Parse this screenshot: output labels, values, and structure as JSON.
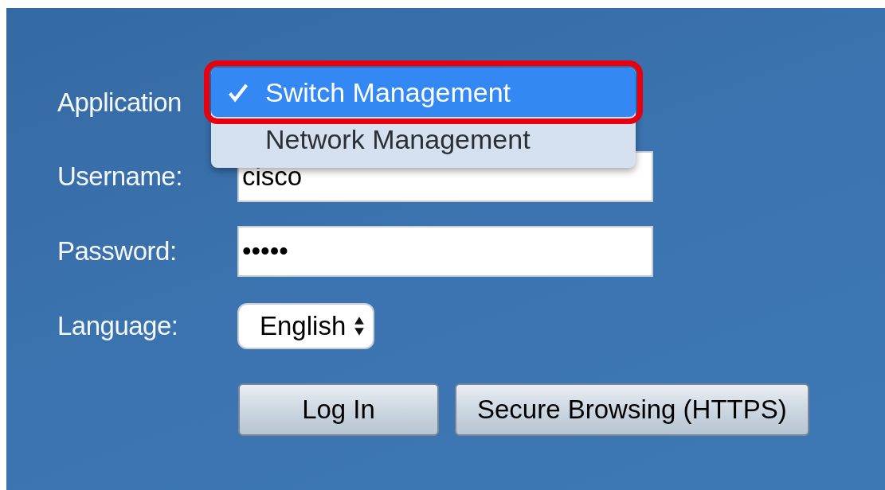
{
  "form": {
    "rows": [
      {
        "kind": "application",
        "label": "Application"
      },
      {
        "kind": "text",
        "label": "Username:",
        "value": "cisco"
      },
      {
        "kind": "text",
        "label": "Password:",
        "value": "•••••"
      },
      {
        "kind": "select",
        "label": "Language:",
        "value": "English"
      }
    ]
  },
  "application_menu": {
    "items": [
      {
        "label": "Switch Management",
        "selected": true,
        "checked": true,
        "highlighted": true
      },
      {
        "label": "Network Management",
        "selected": false,
        "checked": false,
        "highlighted": false
      }
    ]
  },
  "buttons": [
    {
      "label": "Log In"
    },
    {
      "label": "Secure Browsing (HTTPS)"
    }
  ]
}
